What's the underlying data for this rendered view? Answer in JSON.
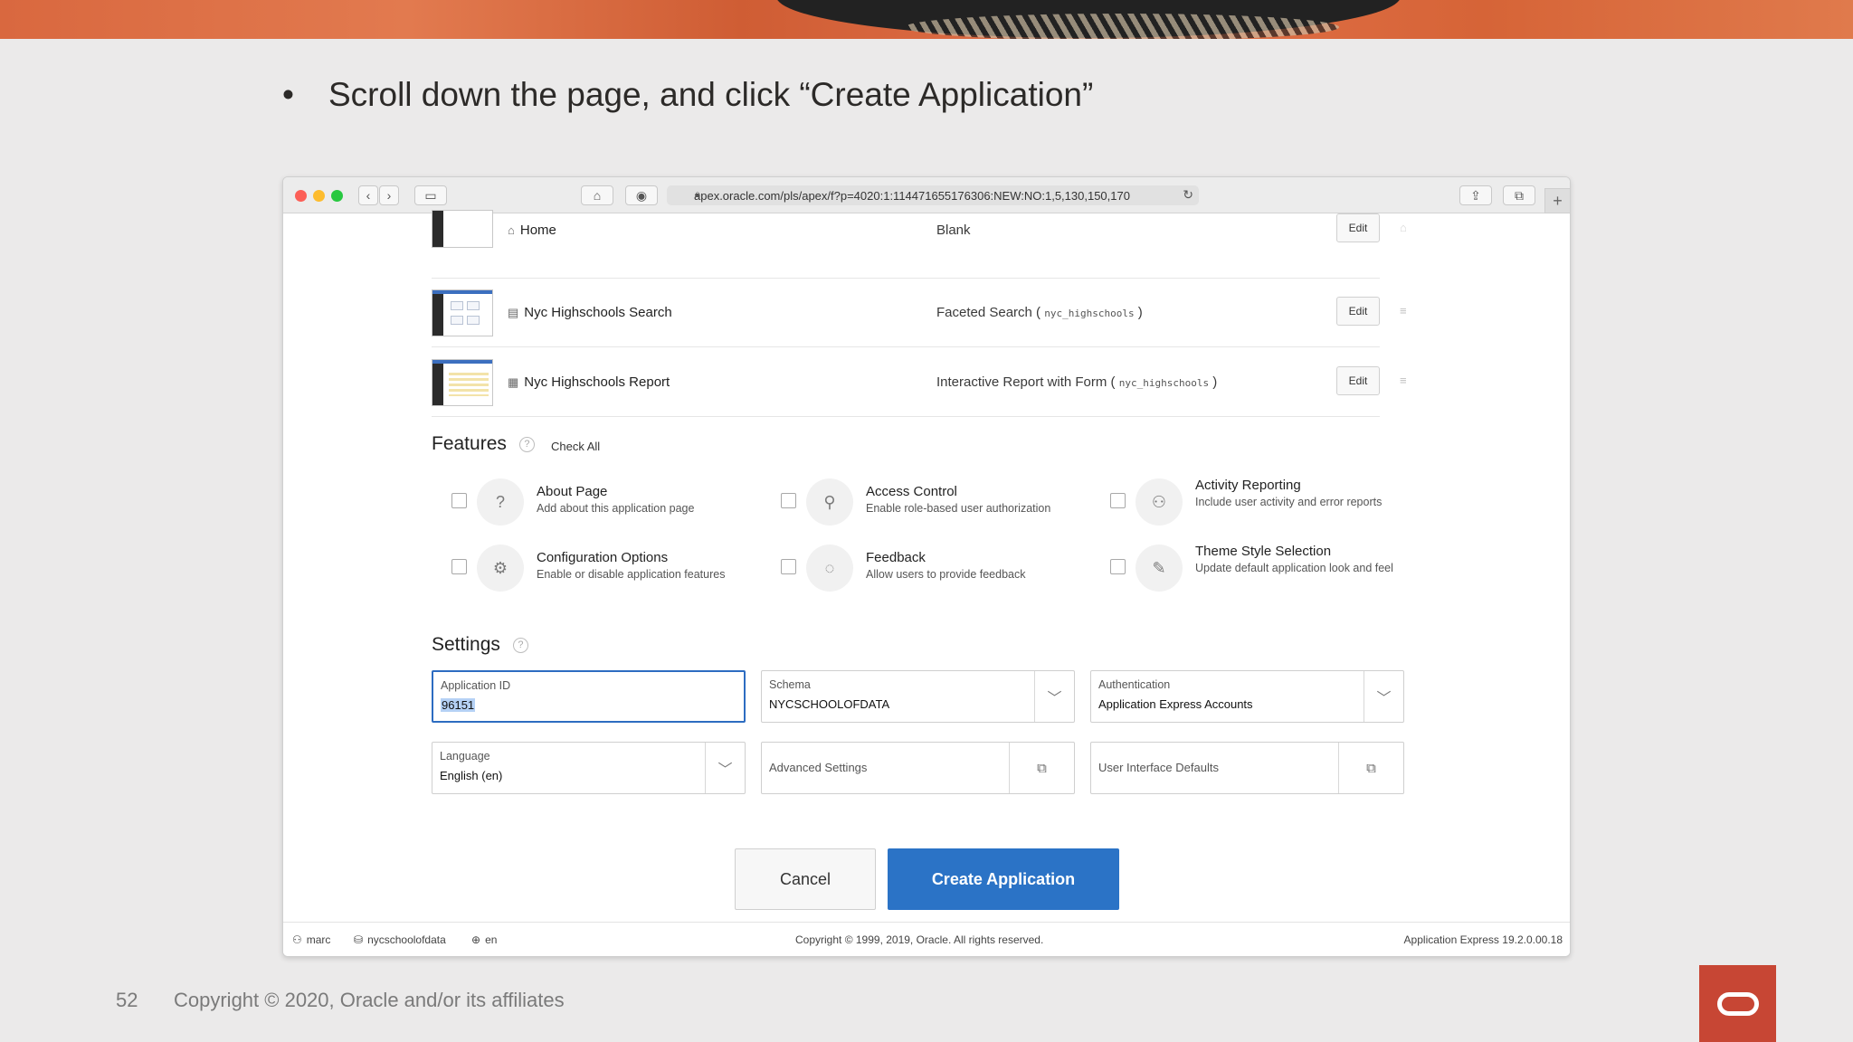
{
  "slide": {
    "bullet": "•",
    "instruction": "Scroll down the page, and click “Create Application”",
    "page_number": "52",
    "copyright": "Copyright © 2020, Oracle and/or its affiliates"
  },
  "browser": {
    "url": "apex.oracle.com/pls/apex/f?p=4020:1:114471655176306:NEW:NO:1,5,130,150,170",
    "new_tab": "+"
  },
  "pages": [
    {
      "name": "Home",
      "type": "Blank",
      "source": "",
      "edit_label": "Edit"
    },
    {
      "name": "Nyc Highschools Search",
      "type": "Faceted Search (",
      "source": "nyc_highschools",
      "type_end": ")",
      "edit_label": "Edit"
    },
    {
      "name": "Nyc Highschools Report",
      "type": "Interactive Report with Form (",
      "source": "nyc_highschools",
      "type_end": ")",
      "edit_label": "Edit"
    }
  ],
  "features": {
    "title": "Features",
    "check_all": "Check All",
    "items": [
      {
        "title": "About Page",
        "desc": "Add about this application page",
        "icon": "?"
      },
      {
        "title": "Access Control",
        "desc": "Enable role-based user authorization",
        "icon": "⚲"
      },
      {
        "title": "Activity Reporting",
        "desc": "Include user activity and error reports",
        "icon": "⚇"
      },
      {
        "title": "Configuration Options",
        "desc": "Enable or disable application features",
        "icon": "⚙"
      },
      {
        "title": "Feedback",
        "desc": "Allow users to provide feedback",
        "icon": "◌"
      },
      {
        "title": "Theme Style Selection",
        "desc": "Update default application look and feel",
        "icon": "✎"
      }
    ]
  },
  "settings": {
    "title": "Settings",
    "application_id": {
      "label": "Application ID",
      "value": "96151"
    },
    "schema": {
      "label": "Schema",
      "value": "NYCSCHOOLOFDATA"
    },
    "authentication": {
      "label": "Authentication",
      "value": "Application Express Accounts"
    },
    "language": {
      "label": "Language",
      "value": "English (en)"
    },
    "advanced": {
      "label": "Advanced Settings"
    },
    "ui_defaults": {
      "label": "User Interface Defaults"
    }
  },
  "actions": {
    "cancel": "Cancel",
    "create": "Create Application"
  },
  "footer": {
    "user": "marc",
    "workspace": "nycschoolofdata",
    "language": "en",
    "copyright": "Copyright © 1999, 2019, Oracle. All rights reserved.",
    "version": "Application Express 19.2.0.00.18"
  },
  "colors": {
    "primary_button": "#2b73c6",
    "focus_border": "#2d6cc1",
    "oracle_red": "#c74634"
  }
}
